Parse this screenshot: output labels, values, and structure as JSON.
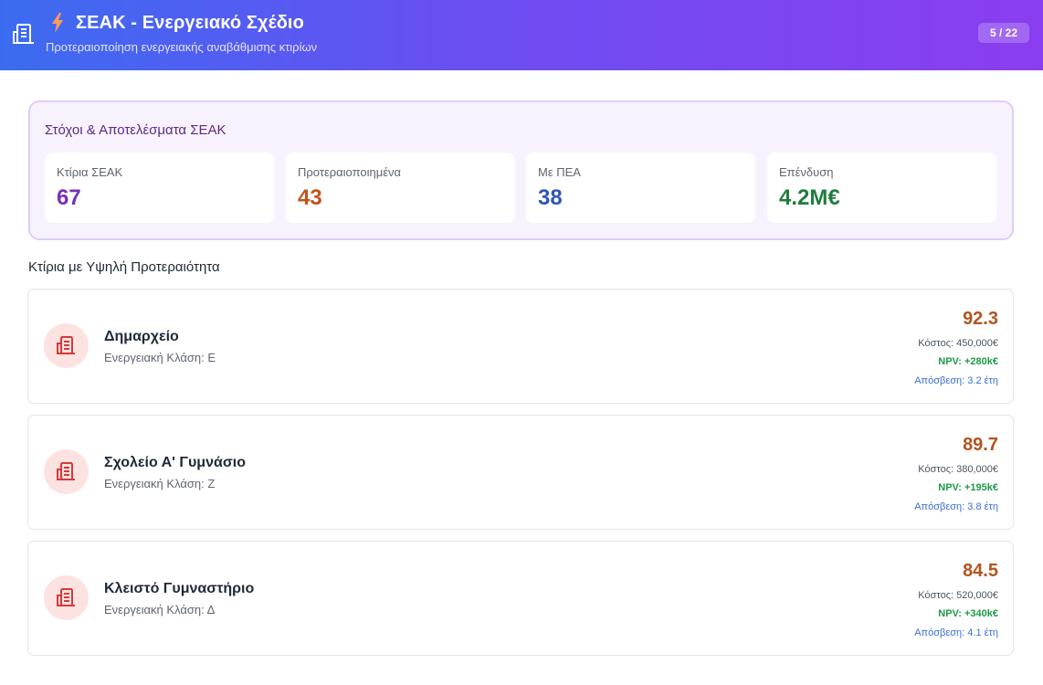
{
  "header": {
    "title": "ΣΕΑΚ - Ενεργειακό Σχέδιο",
    "subtitle": "Προτεραιοποίηση ενεργειακής αναβάθμισης κτιρίων",
    "page_indicator": "5 / 22",
    "app_icon": "building-icon",
    "title_icon": "lightning-bolt-icon"
  },
  "goals": {
    "title": "Στόχοι & Αποτελέσματα ΣΕΑΚ",
    "stats": [
      {
        "label": "Κτίρια ΣΕΑΚ",
        "value": "67",
        "color": "#7a2fb8"
      },
      {
        "label": "Προτεραιοποιημένα",
        "value": "43",
        "color": "#c2541a"
      },
      {
        "label": "Με ΠΕΑ",
        "value": "38",
        "color": "#2f56b5"
      },
      {
        "label": "Επένδυση",
        "value": "4.2M€",
        "color": "#1f7d3f"
      }
    ]
  },
  "priority": {
    "title": "Κτίρια με Υψηλή Προτεραιότητα",
    "buildings": [
      {
        "name": "Δημαρχείο",
        "energy_class": "Ενεργειακή Κλάση: Ε",
        "score": "92.3",
        "cost": "Κόστος: 450,000€",
        "npv": "NPV: +280k€",
        "payback": "Απόσβεση: 3.2 έτη"
      },
      {
        "name": "Σχολείο Α' Γυμνάσιο",
        "energy_class": "Ενεργειακή Κλάση: Ζ",
        "score": "89.7",
        "cost": "Κόστος: 380,000€",
        "npv": "NPV: +195k€",
        "payback": "Απόσβεση: 3.8 έτη"
      },
      {
        "name": "Κλειστό Γυμναστήριο",
        "energy_class": "Ενεργειακή Κλάση: Δ",
        "score": "84.5",
        "cost": "Κόστος: 520,000€",
        "npv": "NPV: +340k€",
        "payback": "Απόσβεση: 4.1 έτη"
      }
    ]
  },
  "colors": {
    "header_start": "#3b6cf0",
    "header_end": "#8b3df0",
    "score": "#b4531e",
    "npv": "#1c9a47",
    "payback": "#3b6fd0",
    "icon_bg": "#fde2e2",
    "icon_fg": "#d93838"
  }
}
